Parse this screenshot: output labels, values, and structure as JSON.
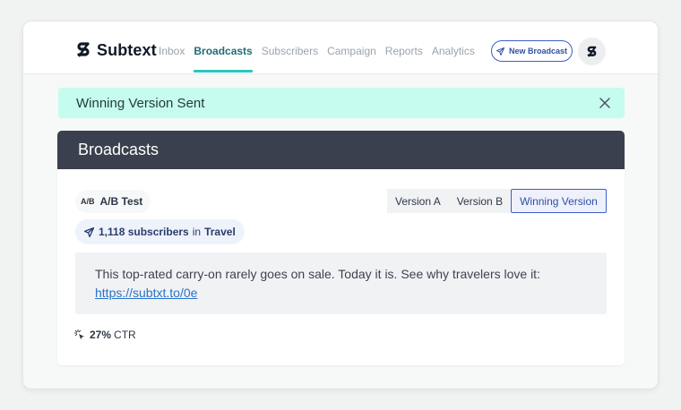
{
  "app": {
    "brand": "Subtext"
  },
  "nav": {
    "items": [
      {
        "label": "Inbox",
        "active": false
      },
      {
        "label": "Broadcasts",
        "active": true
      },
      {
        "label": "Subscribers",
        "active": false
      },
      {
        "label": "Campaign",
        "active": false
      },
      {
        "label": "Reports",
        "active": false
      },
      {
        "label": "Analytics",
        "active": false
      }
    ],
    "new_broadcast_label": "New Broadcast",
    "avatar_icon": "subtext-logo-icon"
  },
  "alert": {
    "message": "Winning Version Sent",
    "close_icon": "close-icon"
  },
  "panel": {
    "title": "Broadcasts",
    "ab_test_label": "A/B Test",
    "ab_icon_glyph": "A/B",
    "version_tabs": [
      {
        "label": "Version A",
        "active": false
      },
      {
        "label": "Version B",
        "active": false
      },
      {
        "label": "Winning Version",
        "active": true
      }
    ],
    "audience": {
      "count": "1,118 subscribers",
      "preposition": "in",
      "segment": "Travel"
    },
    "message": {
      "text": "This top-rated carry-on rarely goes on sale. Today it is. See why travelers love it:",
      "link": "https://subtxt.to/0e"
    },
    "ctr": {
      "value": "27%",
      "label": "CTR"
    }
  },
  "colors": {
    "accent": "#2cc5c0",
    "nav_active": "#1f6e74",
    "primary_blue": "#3b5fc7",
    "alert_bg": "#c6fbf0",
    "panel_header_bg": "#3a404d"
  }
}
